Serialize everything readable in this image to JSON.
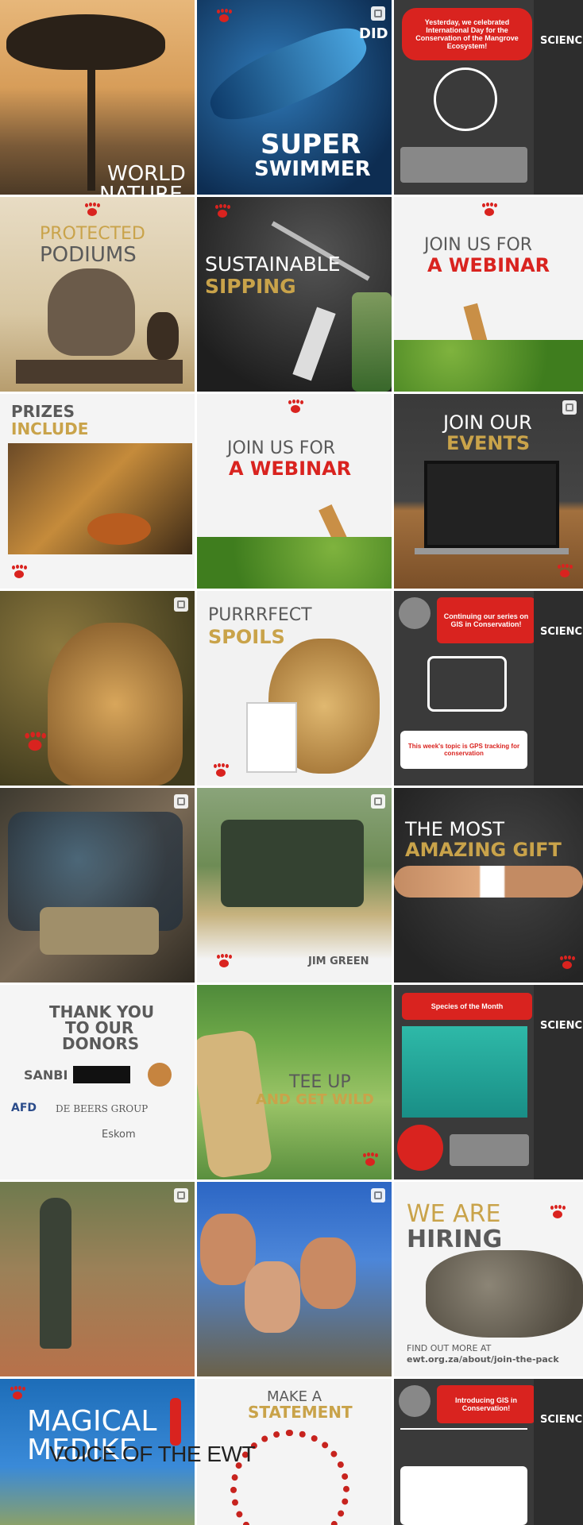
{
  "tiles": [
    {
      "id": "t1",
      "lines": [
        "WORLD",
        "NATURE"
      ]
    },
    {
      "id": "t2",
      "lines": [
        "DID Y",
        "SUPER",
        "SWIMMER"
      ]
    },
    {
      "id": "t3",
      "lines": [
        "Yesterday, we celebrated International Day for the Conservation of the Mangrove Ecosystem!"
      ]
    },
    {
      "id": "t4",
      "lines": [
        "PROTECTED",
        "PODIUMS"
      ]
    },
    {
      "id": "t5",
      "lines": [
        "SUSTAINABLE",
        "SIPPING"
      ]
    },
    {
      "id": "t6",
      "lines": [
        "JOIN US FOR",
        "A WEBINAR"
      ]
    },
    {
      "id": "t7",
      "lines": [
        "PRIZES",
        "INCLUDE"
      ]
    },
    {
      "id": "t8",
      "lines": [
        "JOIN US FOR",
        "A WEBINAR"
      ]
    },
    {
      "id": "t9",
      "lines": [
        "JOIN OUR",
        "EVENTS"
      ]
    },
    {
      "id": "t10",
      "lines": []
    },
    {
      "id": "t11",
      "lines": [
        "PURRRFECT",
        "SPOILS"
      ]
    },
    {
      "id": "t12",
      "lines": [
        "Continuing our series on GIS in Conservation!",
        "This week's topic is GPS tracking for conservation"
      ]
    },
    {
      "id": "t13",
      "lines": []
    },
    {
      "id": "t14",
      "lines": [
        "JIM GREEN"
      ]
    },
    {
      "id": "t15",
      "lines": [
        "THE MOST",
        "AMAZING GIFT"
      ]
    },
    {
      "id": "t16",
      "lines": [
        "THANK YOU",
        "TO OUR",
        "DONORS",
        "SANBI",
        "AFD",
        "DE BEERS GROUP",
        "Eskom"
      ]
    },
    {
      "id": "t17",
      "lines": [
        "TEE UP",
        "AND GET WILD"
      ]
    },
    {
      "id": "t18",
      "lines": [
        "Species of the Month"
      ]
    },
    {
      "id": "t19",
      "lines": []
    },
    {
      "id": "t20",
      "lines": []
    },
    {
      "id": "t21",
      "lines": [
        "WE ARE",
        "HIRING",
        "FIND OUT MORE AT",
        "ewt.org.za/about/join-the-pack"
      ]
    },
    {
      "id": "t22",
      "lines": [
        "MAGICAL",
        "MEDIKE"
      ]
    },
    {
      "id": "t23",
      "lines": [
        "MAKE A",
        "STATEMENT"
      ]
    },
    {
      "id": "t24",
      "lines": [
        "Introducing GIS in Conservation!"
      ]
    }
  ],
  "science_label": "SCIENCE",
  "footer": "VOICE OF THE EWT"
}
